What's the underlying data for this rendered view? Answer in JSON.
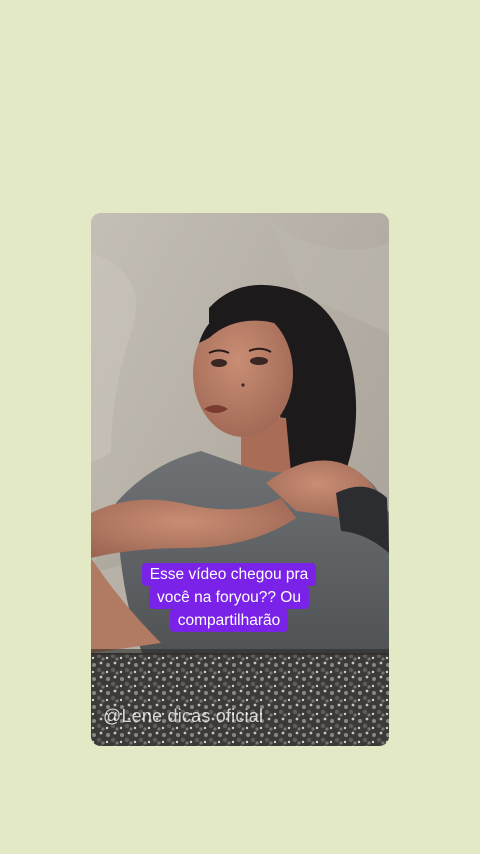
{
  "caption": {
    "lines": [
      "Esse vídeo chegou pra",
      "você na foryou?? Ou",
      "compartilharão"
    ]
  },
  "watermark": {
    "text": "@Lene dicas oficial"
  },
  "colors": {
    "background": "#e3e8c5",
    "caption_bg": "#7a22e8",
    "caption_text": "#ffffff"
  }
}
